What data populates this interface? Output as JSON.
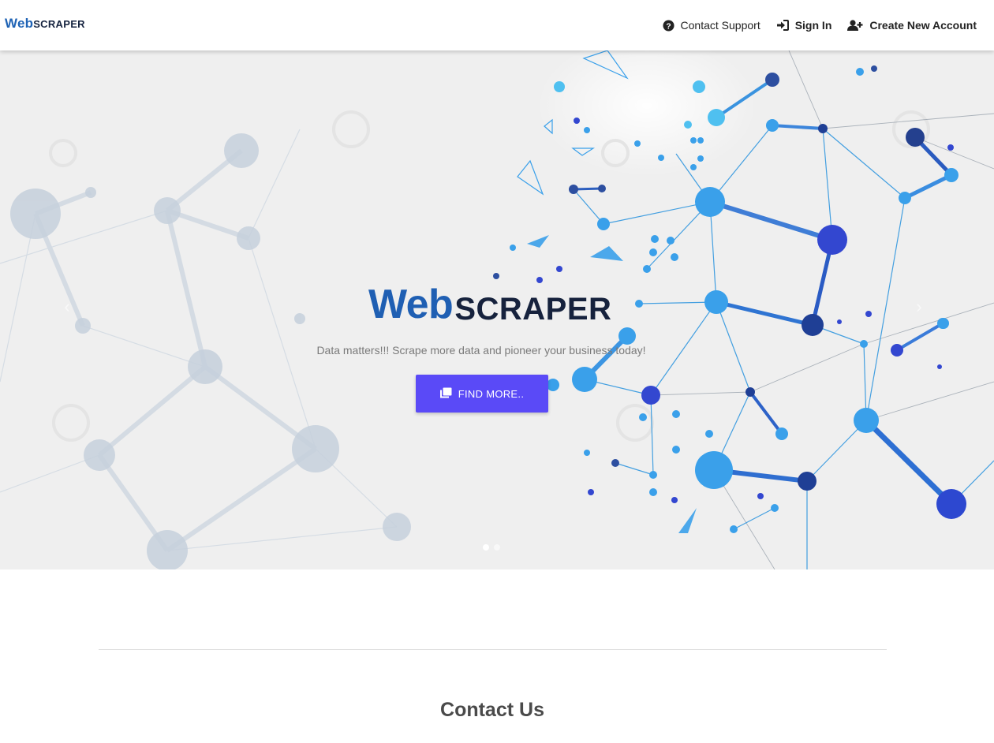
{
  "navbar": {
    "brand": {
      "web": "Web",
      "scraper": "SCRAPER"
    },
    "links": [
      {
        "label": "Contact Support",
        "icon": "question-circle-icon"
      },
      {
        "label": "Sign In",
        "icon": "sign-in-icon"
      },
      {
        "label": "Create New Account",
        "icon": "user-plus-icon"
      }
    ]
  },
  "hero": {
    "logo": {
      "web": "Web",
      "scraper": "SCRAPER"
    },
    "tagline": "Data matters!!! Scrape more data and pioneer your business today!",
    "cta_label": "FIND MORE..",
    "cta_icon": "clone-icon",
    "prev_icon": "chevron-left-icon",
    "next_icon": "chevron-right-icon",
    "slide_count": 2,
    "active_slide": 1
  },
  "contact": {
    "title": "Contact Us"
  },
  "colors": {
    "accent": "#5a4af7",
    "brand_blue": "#1f63b5",
    "brand_dark": "#15233f"
  }
}
